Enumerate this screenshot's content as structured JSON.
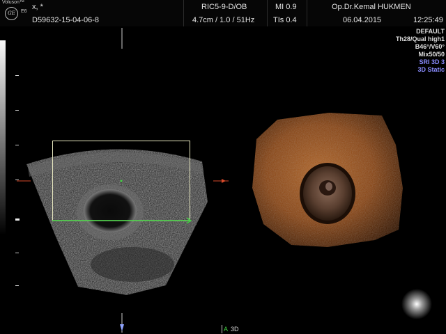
{
  "header": {
    "brand": "Voluson™",
    "model": "E6",
    "logo_text": "GE",
    "markers": "x, *",
    "patient_id": "D59632-15-04-06-8",
    "probe": "RIC5-9-D/OB",
    "depth_info": "4.7cm / 1.0 / 51Hz",
    "mi": "MI 0.9",
    "tis": "TIs 0.4",
    "doctor": "Op.Dr.Kemal HUKMEN",
    "date": "06.04.2015",
    "time": "12:25:49"
  },
  "parameters": [
    {
      "text": "DEFAULT",
      "color": "#e0e0e0"
    },
    {
      "text": "Th28/Qual high1",
      "color": "#e0e0e0"
    },
    {
      "text": "B46°/V60°",
      "color": "#e0e0e0"
    },
    {
      "text": "Mix50/50",
      "color": "#e0e0e0"
    },
    {
      "text": "SRI 3D 3",
      "color": "#8a8cff"
    },
    {
      "text": "3D Static",
      "color": "#8a8cff"
    }
  ],
  "bottom": {
    "plane_label": "A",
    "mode_label": "3D"
  },
  "colors": {
    "render_accent": "#c0783a",
    "roi_box": "#e8e8c0",
    "green_line": "#41d141",
    "red_marker": "#d84a2a"
  }
}
